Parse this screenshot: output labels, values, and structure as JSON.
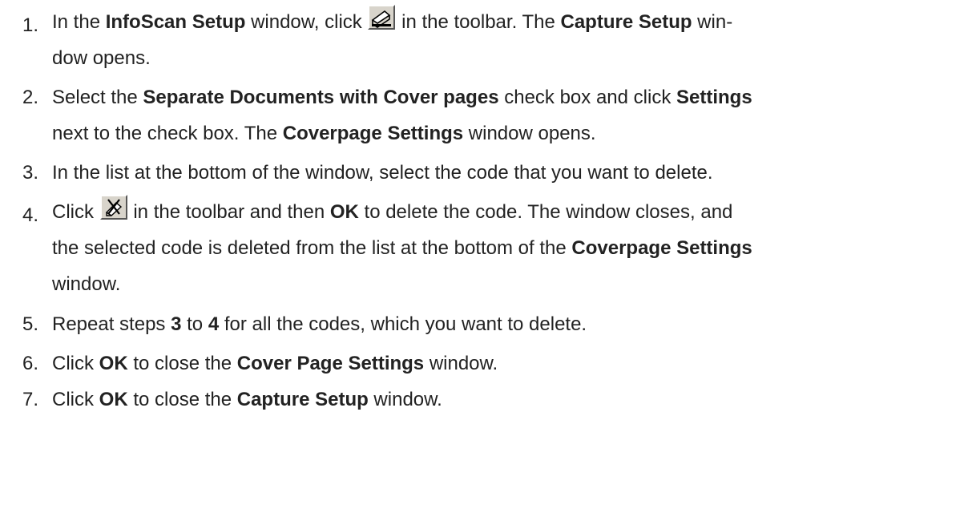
{
  "steps": [
    {
      "number": "1.",
      "parts": [
        "In the ",
        "InfoScan Setup",
        " window, click ",
        " in the toolbar. The ",
        "Capture Setup",
        " win-",
        "dow opens."
      ]
    },
    {
      "number": "2.",
      "parts": [
        "Select the ",
        "Separate Documents with Cover pages",
        " check box and click ",
        "Settings",
        "next to the check box. The ",
        "Coverpage Settings",
        " window opens."
      ]
    },
    {
      "number": "3.",
      "parts": [
        "In the list at the bottom of the window, select the code that you want to delete."
      ]
    },
    {
      "number": "4.",
      "parts": [
        "Click ",
        " in the toolbar and then ",
        "OK",
        " to delete the code. The window closes, and",
        "the selected code is deleted from the list at the bottom of the ",
        "Coverpage Settings",
        "window."
      ]
    },
    {
      "number": "5.",
      "parts": [
        "Repeat steps ",
        "3",
        " to ",
        "4",
        " for all the codes, which you want to delete."
      ]
    },
    {
      "number": "6.",
      "parts": [
        "Click ",
        "OK",
        " to close the ",
        "Cover Page Settings",
        " window."
      ]
    },
    {
      "number": "7.",
      "parts": [
        "Click ",
        "OK",
        " to close the ",
        "Capture Setup",
        " window."
      ]
    }
  ],
  "icons": {
    "capture_setup": "scanner-icon",
    "delete_code": "delete-code-icon"
  },
  "colors": {
    "text": "#222222",
    "icon_face": "#d8d4cb"
  }
}
